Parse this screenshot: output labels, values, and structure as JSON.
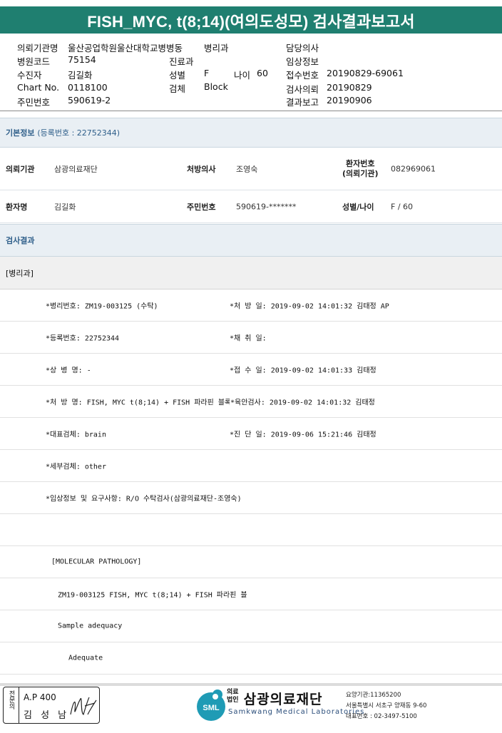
{
  "title": "FISH_MYC, t(8;14)(여의도성모) 검사결과보고서",
  "header": {
    "institution_label": "의뢰기관명",
    "institution": "울산공업학원울산대학교병병동",
    "dept": "병리과",
    "doctor_label": "담당의사",
    "doctor": "",
    "hospital_code_label": "병원코드",
    "hospital_code": "75154",
    "clinic_label": "진료과",
    "clinic": "",
    "clinical_info_label": "임상정보",
    "clinical_info": "",
    "patient_label": "수진자",
    "patient": "김길화",
    "sex_label": "성별",
    "sex": "F",
    "age_label": "나이",
    "age": "60",
    "receipt_no_label": "접수번호",
    "receipt_no": "20190829-69061",
    "chart_label": "Chart No.",
    "chart": "0118100",
    "specimen_label": "검체",
    "specimen": "Block",
    "request_date_label": "검사의뢰",
    "request_date": "20190829",
    "rrn_label": "주민번호",
    "rrn": "590619-2",
    "report_date_label": "결과보고",
    "report_date": "20190906"
  },
  "basic_info": {
    "section_title": "기본정보",
    "reg_no": "(등록번호 : 22752344)",
    "row1": {
      "inst_label": "의뢰기관",
      "inst": "삼광의료재단",
      "prescriber_label": "처방의사",
      "prescriber": "조영숙",
      "patno_label_1": "환자번호",
      "patno_label_2": "(의뢰기관)",
      "patno": "082969061"
    },
    "row2": {
      "name_label": "환자명",
      "name": "김길화",
      "rrn_label": "주민번호",
      "rrn": "590619-*******",
      "sexage_label": "성별/나이",
      "sexage": "F / 60"
    }
  },
  "results": {
    "section_title": "검사결과",
    "dept": "[병리과]",
    "rows": [
      {
        "left": "*병리번호: ZM19-003125 (수탁)",
        "right": "*처 방 일: 2019-09-02 14:01:32  김태정 AP"
      },
      {
        "left": "*등록번호: 22752344",
        "right": "*채 취 일:"
      },
      {
        "left": "*상 병 명: -",
        "right": "*접 수 일: 2019-09-02 14:01:33  김태정"
      },
      {
        "left": "*처 방 명: FISH, MYC t(8;14) + FISH 파라핀 블록",
        "right": "*육안검사: 2019-09-02 14:01:32  김태정"
      },
      {
        "left": "*대표검체: brain",
        "right": "*진 단 일: 2019-09-06 15:21:46  김태정"
      },
      {
        "left": "*세부검체: other",
        "right": ""
      },
      {
        "left": "*임상정보 및 요구사항: R/O 수탁검사(삼광의료재단-조영숙)",
        "right": ""
      }
    ],
    "molecular": "[MOLECULAR PATHOLOGY]",
    "test_line": "ZM19-003125     FISH, MYC t(8;14) + FISH 파라핀 블",
    "sample_adequacy": "Sample adequacy",
    "adequate": "Adequate"
  },
  "footer": {
    "stamp_vertical": "전문의",
    "stamp_line1": "A.P 400",
    "stamp_line2": "김 성 남",
    "org_prefix_1": "의료",
    "org_prefix_2": "법인",
    "org_name": "삼광의료재단",
    "org_en": "Samkwang Medical Laboratories",
    "logo_abbr": "SML",
    "contact1": "요양기관:11365200",
    "contact2": "서울특별시 서초구 양재동 9-60",
    "contact3": "대표번호 : 02-3497-5100",
    "brand_color": "#1f9bb5"
  }
}
